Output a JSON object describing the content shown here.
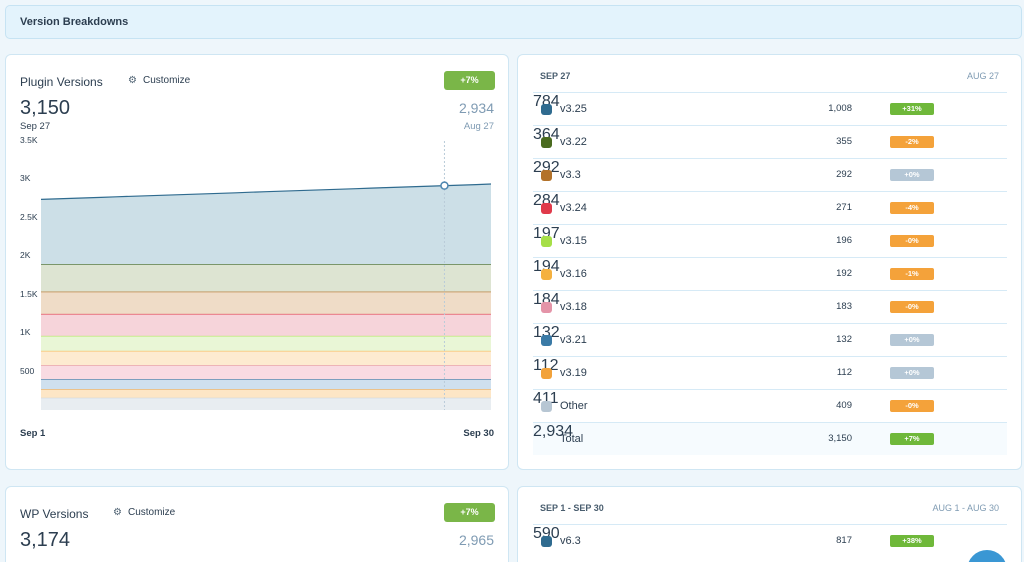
{
  "section_title": "Version Breakdowns",
  "plugin_card": {
    "title": "Plugin Versions",
    "customize_label": "Customize",
    "change_badge": "+7%",
    "current_value": "3,150",
    "current_date": "Sep 27",
    "previous_value": "2,934",
    "previous_date": "Aug 27",
    "x_start": "Sep 1",
    "x_end": "Sep 30"
  },
  "wp_card": {
    "title": "WP Versions",
    "customize_label": "Customize",
    "change_badge": "+7%",
    "current_value": "3,174",
    "previous_value": "2,965"
  },
  "plugin_table": {
    "current_header": "SEP 27",
    "previous_header": "AUG 27",
    "rows": [
      {
        "name": "v3.25",
        "count": "1,008",
        "change": "+31%",
        "previous": "784",
        "color": "#2f6b8f",
        "badge_color": "#6fb83a"
      },
      {
        "name": "v3.22",
        "count": "355",
        "change": "-2%",
        "previous": "364",
        "color": "#4a6b1f",
        "badge_color": "#f4a23a"
      },
      {
        "name": "v3.3",
        "count": "292",
        "change": "+0%",
        "previous": "292",
        "color": "#b3722a",
        "badge_color": "#b5c7d6"
      },
      {
        "name": "v3.24",
        "count": "271",
        "change": "-4%",
        "previous": "284",
        "color": "#e03a4a",
        "badge_color": "#f4a23a"
      },
      {
        "name": "v3.15",
        "count": "196",
        "change": "-0%",
        "previous": "197",
        "color": "#a6df47",
        "badge_color": "#f4a23a"
      },
      {
        "name": "v3.16",
        "count": "192",
        "change": "-1%",
        "previous": "194",
        "color": "#f5b13f",
        "badge_color": "#f4a23a"
      },
      {
        "name": "v3.18",
        "count": "183",
        "change": "-0%",
        "previous": "184",
        "color": "#e494a8",
        "badge_color": "#f4a23a"
      },
      {
        "name": "v3.21",
        "count": "132",
        "change": "+0%",
        "previous": "132",
        "color": "#3a7aa6",
        "badge_color": "#b5c7d6"
      },
      {
        "name": "v3.19",
        "count": "112",
        "change": "+0%",
        "previous": "112",
        "color": "#f2a23a",
        "badge_color": "#b5c7d6"
      },
      {
        "name": "Other",
        "count": "409",
        "change": "-0%",
        "previous": "411",
        "color": "#b7c6d3",
        "badge_color": "#f4a23a"
      }
    ],
    "total": {
      "name": "Total",
      "count": "3,150",
      "change": "+7%",
      "previous": "2,934",
      "badge_color": "#6fb83a"
    }
  },
  "wp_table": {
    "current_header": "SEP 1 - SEP 30",
    "previous_header": "AUG 1 - AUG 30",
    "rows": [
      {
        "name": "v6.3",
        "count": "817",
        "change": "+38%",
        "previous": "590",
        "color": "#2f6b8f",
        "badge_color": "#6fb83a"
      }
    ]
  },
  "chart_data": {
    "type": "area",
    "stacked": true,
    "x_start": "Sep 1",
    "x_end": "Sep 30",
    "ylim": [
      0,
      3500
    ],
    "yticks": [
      500,
      1000,
      1500,
      2000,
      2500,
      3000,
      3500
    ],
    "ytick_labels": [
      "500",
      "1K",
      "1.5K",
      "2K",
      "2.5K",
      "3K",
      "3.5K"
    ],
    "highlight_x": "Sep 27",
    "series_top_start": 2980,
    "series_top_end": 3180,
    "layers": [
      {
        "name": "Other",
        "value": 160,
        "color": "#e8edf1",
        "line": "#c9d4dd"
      },
      {
        "name": "v3.19",
        "value": 110,
        "color": "#fde6c6",
        "line": "#f2a23a"
      },
      {
        "name": "v3.21",
        "value": 130,
        "color": "#cfe0ee",
        "line": "#3a7aa6"
      },
      {
        "name": "v3.18",
        "value": 180,
        "color": "#f9dbe2",
        "line": "#e494a8"
      },
      {
        "name": "v3.16",
        "value": 190,
        "color": "#fdebd0",
        "line": "#f5b13f"
      },
      {
        "name": "v3.15",
        "value": 195,
        "color": "#e9f6d6",
        "line": "#a6df47"
      },
      {
        "name": "v3.24",
        "value": 285,
        "color": "#f6d4da",
        "line": "#e03a4a"
      },
      {
        "name": "v3.3",
        "value": 290,
        "color": "#efdcc7",
        "line": "#b3722a"
      },
      {
        "name": "v3.22",
        "value": 355,
        "color": "#dde4d2",
        "line": "#4a6b1f"
      },
      {
        "name": "v3.25",
        "value_start": 845,
        "value_end": 1045,
        "color": "#ccdfe7",
        "line": "#2f6b8f"
      }
    ]
  }
}
